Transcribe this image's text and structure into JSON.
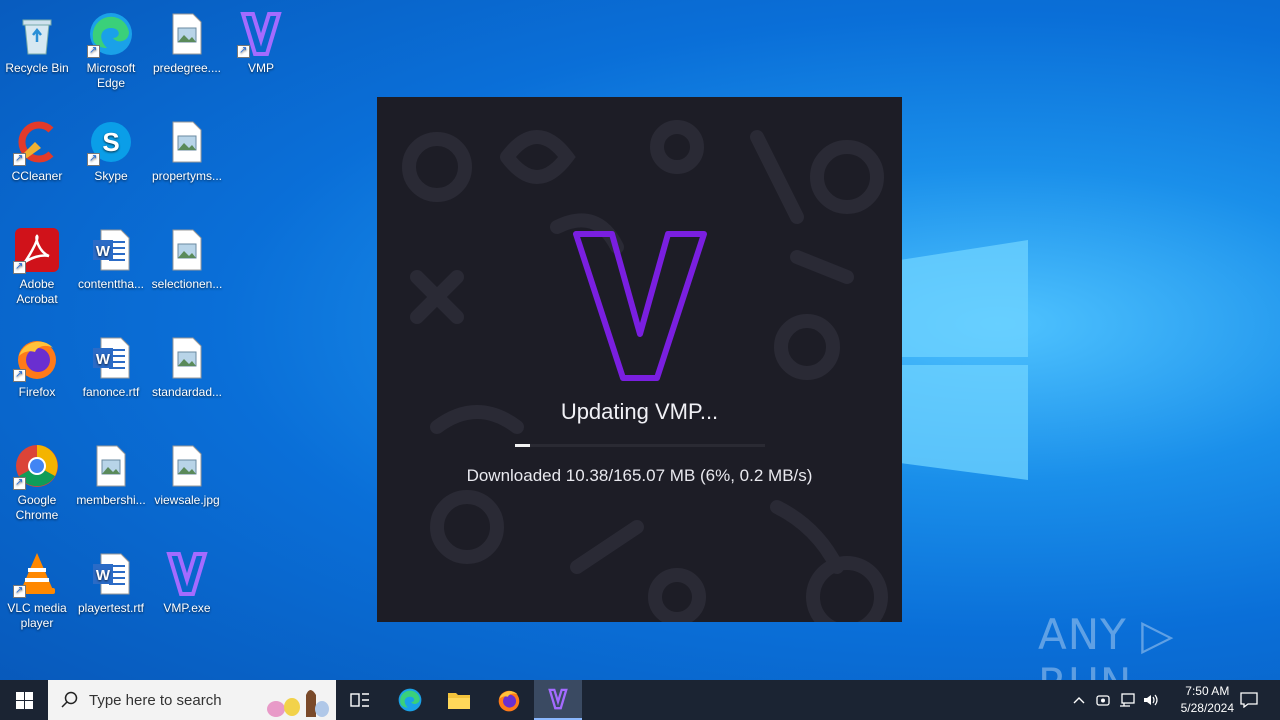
{
  "desktop": {
    "icons": [
      {
        "label": "Recycle Bin",
        "icon": "recycle-bin-icon"
      },
      {
        "label": "Microsoft\nEdge",
        "icon": "edge-icon"
      },
      {
        "label": "predegree....",
        "icon": "image-file-icon"
      },
      {
        "label": "VMP",
        "icon": "vmp-icon"
      },
      {
        "label": "CCleaner",
        "icon": "ccleaner-icon"
      },
      {
        "label": "Skype",
        "icon": "skype-icon"
      },
      {
        "label": "propertyms...",
        "icon": "image-file-icon"
      },
      {
        "label": "Adobe\nAcrobat",
        "icon": "acrobat-icon"
      },
      {
        "label": "contenttha...",
        "icon": "word-file-icon"
      },
      {
        "label": "selectionen...",
        "icon": "image-file-icon"
      },
      {
        "label": "Firefox",
        "icon": "firefox-icon"
      },
      {
        "label": "fanonce.rtf",
        "icon": "word-file-icon"
      },
      {
        "label": "standardad...",
        "icon": "image-file-icon"
      },
      {
        "label": "Google\nChrome",
        "icon": "chrome-icon"
      },
      {
        "label": "membershi...",
        "icon": "image-file-icon"
      },
      {
        "label": "viewsale.jpg",
        "icon": "image-file-icon"
      },
      {
        "label": "VLC media\nplayer",
        "icon": "vlc-icon"
      },
      {
        "label": "playertest.rtf",
        "icon": "word-file-icon"
      },
      {
        "label": "VMP.exe",
        "icon": "vmp-icon"
      }
    ]
  },
  "updater": {
    "title": "Updating VMP...",
    "status": "Downloaded 10.38/165.07 MB (6%, 0.2 MB/s)",
    "progress": 0.06,
    "accent": "#7a1fe0"
  },
  "watermark": "ANY ▷ RUN",
  "taskbar": {
    "search_placeholder": "Type here to search",
    "time": "7:50 AM",
    "date": "5/28/2024"
  }
}
